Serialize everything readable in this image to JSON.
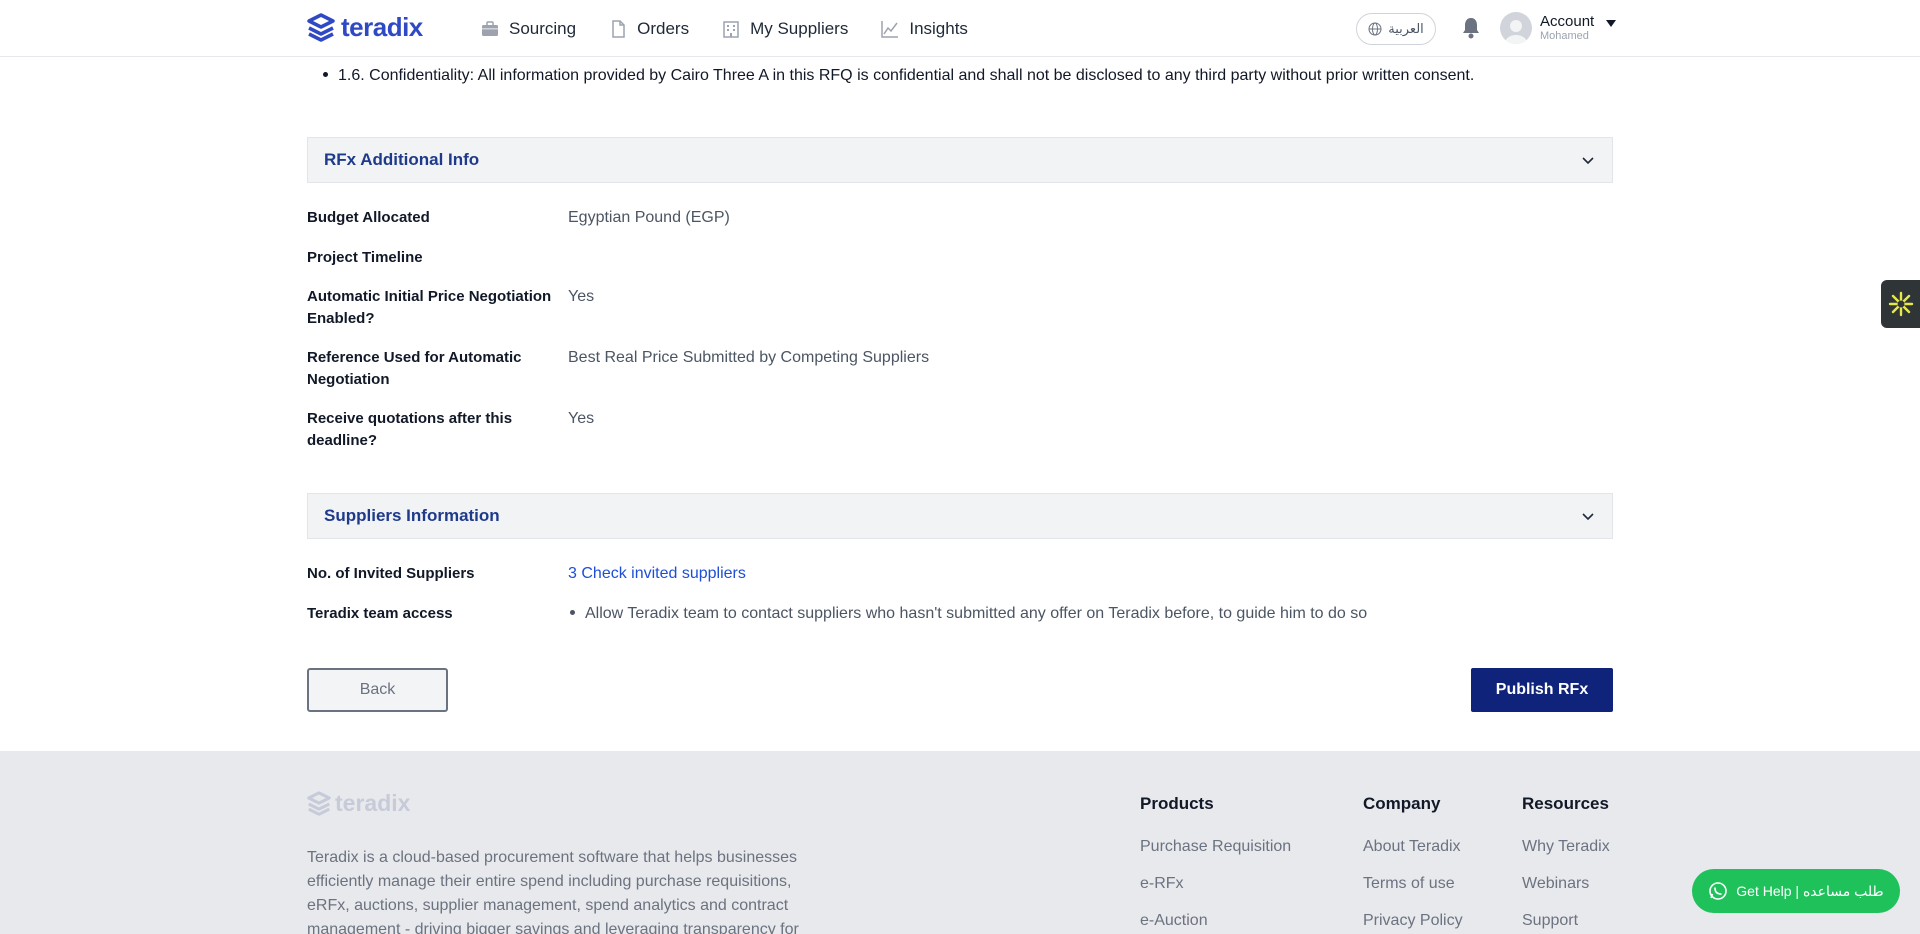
{
  "header": {
    "logo_text": "teradix",
    "nav": [
      {
        "label": "Sourcing",
        "icon": "briefcase-icon"
      },
      {
        "label": "Orders",
        "icon": "document-icon"
      },
      {
        "label": "My Suppliers",
        "icon": "building-icon"
      },
      {
        "label": "Insights",
        "icon": "chart-line-icon"
      }
    ],
    "language_label": "العربية",
    "account_label": "Account",
    "account_user": "Mohamed"
  },
  "terms": {
    "confidentiality": "1.6. Confidentiality: All information provided by Cairo Three A in this RFQ is confidential and shall not be disclosed to any third party without prior written consent."
  },
  "additional_info": {
    "title": "RFx Additional Info",
    "rows": [
      {
        "label": "Budget Allocated",
        "value": "Egyptian Pound (EGP)"
      },
      {
        "label": "Project Timeline",
        "value": ""
      },
      {
        "label": "Automatic Initial Price Negotiation Enabled?",
        "value": "Yes"
      },
      {
        "label": "Reference Used for Automatic Negotiation",
        "value": "Best Real Price Submitted by Competing Suppliers"
      },
      {
        "label": "Receive quotations after this deadline?",
        "value": "Yes"
      }
    ]
  },
  "suppliers_info": {
    "title": "Suppliers Information",
    "invited_label": "No. of Invited Suppliers",
    "invited_count": "3",
    "invited_link": "Check invited suppliers",
    "team_access_label": "Teradix team access",
    "team_access_value": "Allow Teradix team to contact suppliers who hasn't submitted any offer on Teradix before, to guide him to do so"
  },
  "actions": {
    "back_label": "Back",
    "publish_label": "Publish RFx"
  },
  "footer": {
    "logo_text": "teradix",
    "description": "Teradix is a cloud-based procurement software that helps businesses efficiently manage their entire spend including purchase requisitions, eRFx, auctions, supplier management, spend analytics and contract management - driving bigger savings and leveraging transparency for",
    "columns": [
      {
        "title": "Products",
        "links": [
          "Purchase Requisition",
          "e-RFx",
          "e-Auction"
        ]
      },
      {
        "title": "Company",
        "links": [
          "About Teradix",
          "Terms of use",
          "Privacy Policy"
        ]
      },
      {
        "title": "Resources",
        "links": [
          "Why Teradix",
          "Webinars",
          "Support"
        ]
      }
    ]
  },
  "help_button_label": "Get Help | طلب مساعده",
  "colors": {
    "brand": "#2f49c4",
    "primary_button": "#0f237a",
    "section_title": "#1e3a8a",
    "link": "#1d4ed8",
    "help_green": "#1fc15b"
  }
}
